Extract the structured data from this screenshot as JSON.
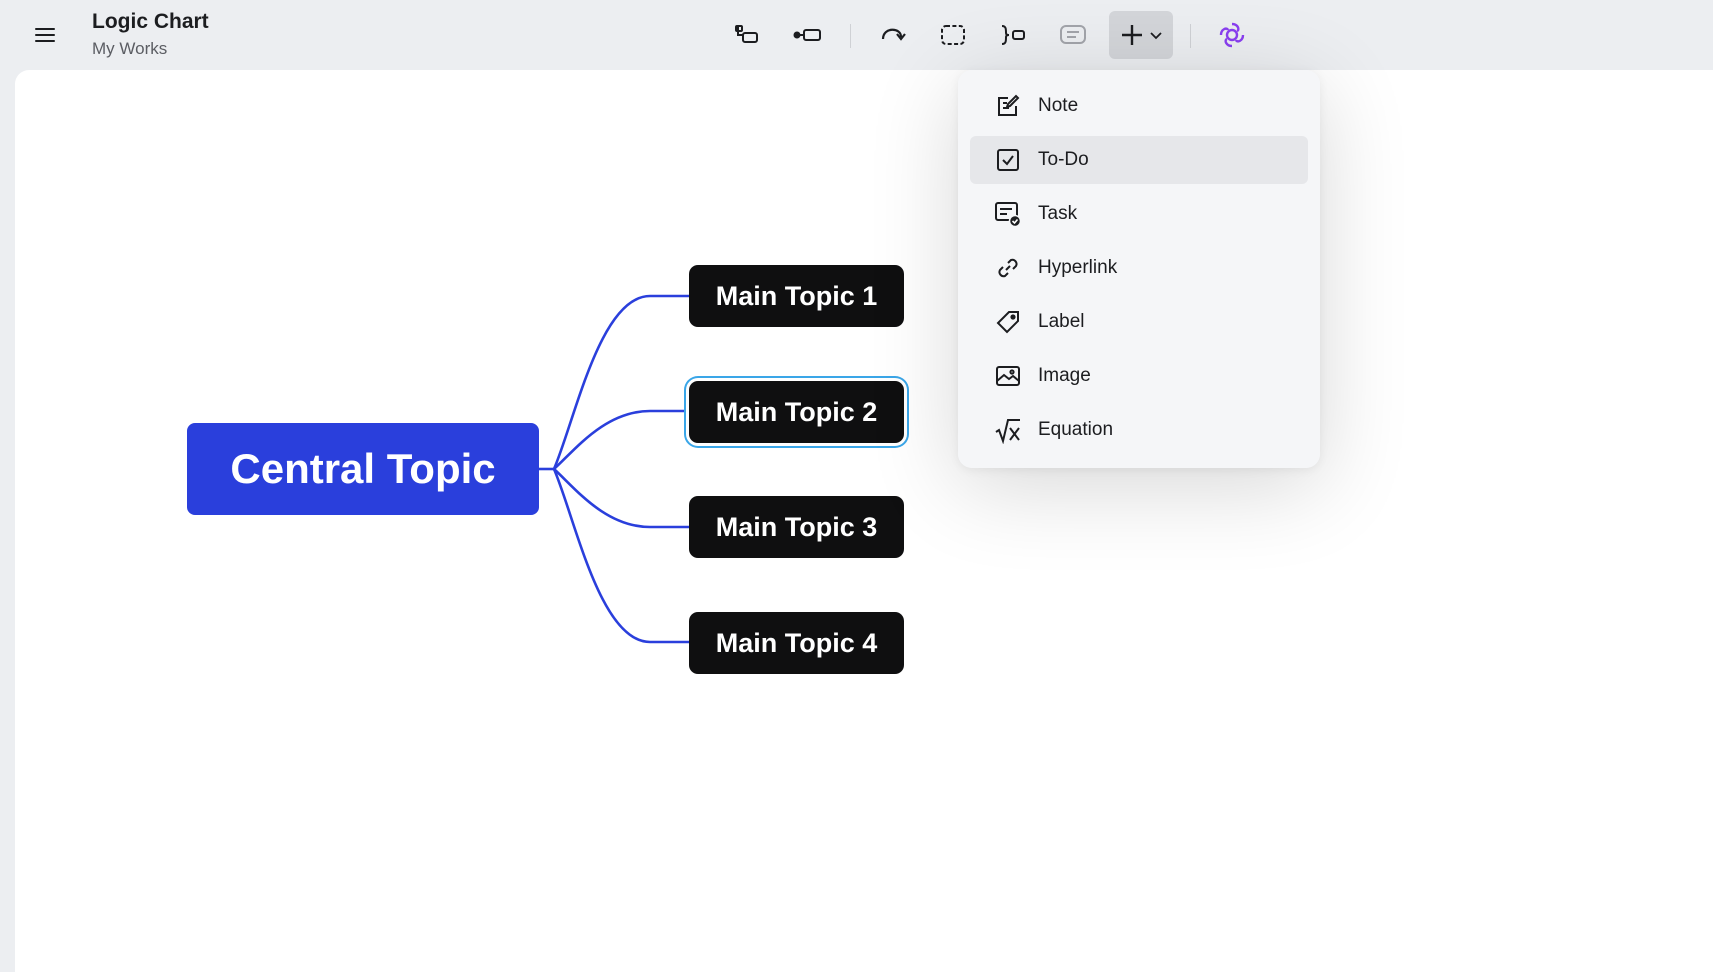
{
  "header": {
    "title": "Logic Chart",
    "subtitle": "My Works"
  },
  "toolbar": {
    "tools": [
      {
        "name": "insert-subtopic",
        "icon": "subtopic-icon"
      },
      {
        "name": "insert-topic",
        "icon": "topic-icon"
      },
      {
        "name": "relationship",
        "icon": "relationship-icon"
      },
      {
        "name": "boundary",
        "icon": "boundary-icon"
      },
      {
        "name": "summary",
        "icon": "summary-icon"
      },
      {
        "name": "notes",
        "icon": "comment-icon"
      },
      {
        "name": "insert",
        "icon": "plus-icon",
        "active": true
      },
      {
        "name": "ai",
        "icon": "ai-icon"
      }
    ]
  },
  "mindmap": {
    "central": "Central Topic",
    "topics": [
      "Main Topic 1",
      "Main Topic 2",
      "Main Topic 3",
      "Main Topic 4"
    ],
    "selected_index": 1
  },
  "insert_menu": {
    "items": [
      {
        "label": "Note",
        "icon": "note-icon"
      },
      {
        "label": "To-Do",
        "icon": "checkbox-icon"
      },
      {
        "label": "Task",
        "icon": "task-icon"
      },
      {
        "label": "Hyperlink",
        "icon": "link-icon"
      },
      {
        "label": "Label",
        "icon": "tag-icon"
      },
      {
        "label": "Image",
        "icon": "image-icon"
      },
      {
        "label": "Equation",
        "icon": "equation-icon"
      }
    ],
    "hovered_index": 1
  },
  "colors": {
    "central_fill": "#2a3fdc",
    "topic_fill": "#0f0f10",
    "connector": "#2a3fdc",
    "selection_ring": "#3aa6e8",
    "ai_accent": "#8a3ff0"
  }
}
